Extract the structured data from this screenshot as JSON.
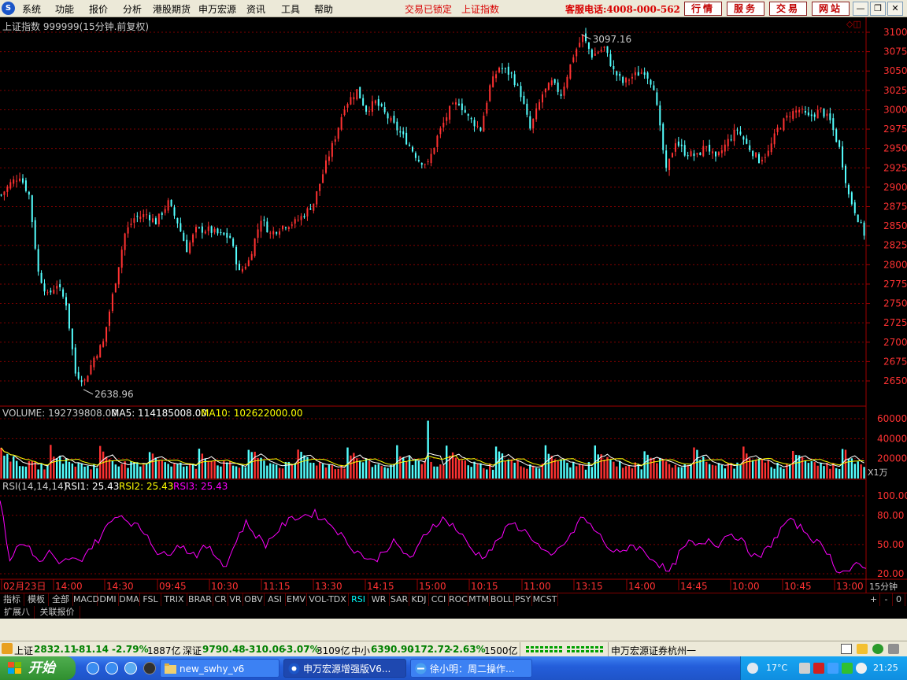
{
  "menubar": {
    "app_icon_glyph": "S",
    "items": [
      "系统",
      "功能",
      "报价",
      "分析",
      "港股期货",
      "申万宏源",
      "资讯",
      "工具",
      "帮助"
    ],
    "lock_status": "交易已锁定",
    "current_index": "上证指数",
    "hotline": "客服电话:4008-000-562",
    "buttons": [
      "行情",
      "服务",
      "交易",
      "网站"
    ],
    "window_controls": [
      "—",
      "❐",
      "✕"
    ]
  },
  "chart": {
    "title": "上证指数 999999(15分钟.前复权)",
    "high_label": "3097.16",
    "low_label": "2638.96",
    "price_ticks": [
      3100,
      3075,
      3050,
      3025,
      3000,
      2975,
      2950,
      2925,
      2900,
      2875,
      2850,
      2825,
      2800,
      2775,
      2750,
      2725,
      2700,
      2675,
      2650
    ],
    "volume": {
      "label": "VOLUME: 192739808.00",
      "ma5": "MA5: 114185008.00",
      "ma10": "MA10: 102622000.00",
      "ticks": [
        "60000",
        "40000",
        "20000"
      ],
      "unit": "X1万"
    },
    "rsi": {
      "label": "RSI(14,14,14)",
      "rsi1": "RSI1: 25.43",
      "rsi2": "RSI2: 25.43",
      "rsi3": "RSI3: 25.43",
      "ticks": [
        "100.00",
        "80.00",
        "50.00",
        "20.00"
      ]
    },
    "time_labels": [
      "02月23日",
      "14:00",
      "14:30",
      "09:45",
      "10:30",
      "11:15",
      "13:30",
      "14:15",
      "15:00",
      "10:15",
      "11:00",
      "13:15",
      "14:00",
      "14:45",
      "10:00",
      "10:45",
      "13:00"
    ],
    "period": "15分钟",
    "colors": {
      "up": "#ff3232",
      "down": "#54ffff",
      "ma5": "#ffffff",
      "ma10": "#ffff00",
      "rsi": "#ff00ff",
      "grid": "#800000"
    }
  },
  "chart_data": {
    "type": "candlestick",
    "title": "上证指数 999999(15分钟.前复权)",
    "ylim": [
      2625,
      3110
    ],
    "y_ticks": [
      3100,
      3075,
      3050,
      3025,
      3000,
      2975,
      2950,
      2925,
      2900,
      2875,
      2850,
      2825,
      2800,
      2775,
      2750,
      2725,
      2700,
      2675,
      2650
    ],
    "annotations": [
      {
        "label": "3097.16",
        "value": 3097.16
      },
      {
        "label": "2638.96",
        "value": 2638.96
      }
    ],
    "close_path": [
      [
        0,
        2890
      ],
      [
        3,
        2905
      ],
      [
        6,
        2915
      ],
      [
        9,
        2890
      ],
      [
        12,
        2790
      ],
      [
        15,
        2760
      ],
      [
        18,
        2775
      ],
      [
        21,
        2750
      ],
      [
        24,
        2660
      ],
      [
        27,
        2650
      ],
      [
        30,
        2680
      ],
      [
        33,
        2700
      ],
      [
        37,
        2780
      ],
      [
        40,
        2840
      ],
      [
        43,
        2860
      ],
      [
        47,
        2865
      ],
      [
        50,
        2855
      ],
      [
        54,
        2880
      ],
      [
        57,
        2855
      ],
      [
        60,
        2820
      ],
      [
        63,
        2845
      ],
      [
        67,
        2845
      ],
      [
        70,
        2840
      ],
      [
        74,
        2835
      ],
      [
        77,
        2790
      ],
      [
        80,
        2805
      ],
      [
        84,
        2860
      ],
      [
        87,
        2840
      ],
      [
        91,
        2850
      ],
      [
        95,
        2855
      ],
      [
        98,
        2865
      ],
      [
        101,
        2880
      ],
      [
        105,
        2930
      ],
      [
        108,
        2965
      ],
      [
        111,
        3005
      ],
      [
        115,
        3025
      ],
      [
        118,
        3000
      ],
      [
        121,
        3010
      ],
      [
        125,
        2990
      ],
      [
        128,
        2975
      ],
      [
        131,
        2960
      ],
      [
        135,
        2935
      ],
      [
        138,
        2930
      ],
      [
        141,
        2965
      ],
      [
        145,
        3000
      ],
      [
        148,
        3010
      ],
      [
        151,
        2990
      ],
      [
        155,
        2975
      ],
      [
        158,
        3030
      ],
      [
        161,
        3055
      ],
      [
        165,
        3045
      ],
      [
        168,
        3020
      ],
      [
        171,
        2975
      ],
      [
        175,
        3020
      ],
      [
        178,
        3035
      ],
      [
        181,
        3020
      ],
      [
        185,
        3070
      ],
      [
        188,
        3095
      ],
      [
        191,
        3070
      ],
      [
        195,
        3080
      ],
      [
        198,
        3050
      ],
      [
        201,
        3035
      ],
      [
        205,
        3045
      ],
      [
        208,
        3050
      ],
      [
        211,
        3030
      ],
      [
        215,
        2920
      ],
      [
        218,
        2960
      ],
      [
        221,
        2945
      ],
      [
        225,
        2940
      ],
      [
        228,
        2955
      ],
      [
        231,
        2935
      ],
      [
        235,
        2960
      ],
      [
        238,
        2975
      ],
      [
        241,
        2955
      ],
      [
        245,
        2935
      ],
      [
        248,
        2945
      ],
      [
        251,
        2975
      ],
      [
        255,
        2995
      ],
      [
        258,
        3000
      ],
      [
        261,
        2990
      ],
      [
        265,
        3000
      ],
      [
        268,
        2985
      ],
      [
        271,
        2950
      ],
      [
        274,
        2890
      ],
      [
        277,
        2860
      ],
      [
        280,
        2830
      ]
    ],
    "volume_ticks": [
      60000,
      40000,
      20000
    ],
    "rsi_ticks": [
      100,
      80,
      50,
      20
    ],
    "rsi_path": [
      [
        0,
        95
      ],
      [
        3,
        35
      ],
      [
        6,
        50
      ],
      [
        9,
        48
      ],
      [
        12,
        30
      ],
      [
        15,
        42
      ],
      [
        18,
        28
      ],
      [
        21,
        36
      ],
      [
        24,
        32
      ],
      [
        27,
        45
      ],
      [
        30,
        55
      ],
      [
        33,
        70
      ],
      [
        36,
        82
      ],
      [
        39,
        75
      ],
      [
        42,
        68
      ],
      [
        45,
        60
      ],
      [
        48,
        42
      ],
      [
        51,
        38
      ],
      [
        54,
        52
      ],
      [
        57,
        44
      ],
      [
        60,
        40
      ],
      [
        63,
        48
      ],
      [
        66,
        38
      ],
      [
        69,
        28
      ],
      [
        72,
        55
      ],
      [
        75,
        72
      ],
      [
        78,
        60
      ],
      [
        81,
        50
      ],
      [
        84,
        62
      ],
      [
        87,
        72
      ],
      [
        90,
        78
      ],
      [
        93,
        80
      ],
      [
        96,
        82
      ],
      [
        99,
        75
      ],
      [
        102,
        68
      ],
      [
        105,
        55
      ],
      [
        108,
        45
      ],
      [
        111,
        38
      ],
      [
        114,
        32
      ],
      [
        117,
        44
      ],
      [
        120,
        52
      ],
      [
        123,
        42
      ],
      [
        126,
        36
      ],
      [
        129,
        58
      ],
      [
        132,
        70
      ],
      [
        135,
        76
      ],
      [
        138,
        70
      ],
      [
        141,
        58
      ],
      [
        144,
        44
      ],
      [
        147,
        38
      ],
      [
        150,
        46
      ],
      [
        153,
        60
      ],
      [
        156,
        72
      ],
      [
        159,
        66
      ],
      [
        162,
        58
      ],
      [
        165,
        45
      ],
      [
        168,
        36
      ],
      [
        171,
        48
      ],
      [
        174,
        58
      ],
      [
        177,
        78
      ],
      [
        180,
        70
      ],
      [
        183,
        58
      ],
      [
        186,
        45
      ],
      [
        189,
        40
      ],
      [
        192,
        50
      ],
      [
        195,
        46
      ],
      [
        198,
        38
      ],
      [
        201,
        30
      ],
      [
        204,
        20
      ],
      [
        207,
        40
      ],
      [
        210,
        52
      ],
      [
        213,
        48
      ],
      [
        216,
        56
      ],
      [
        219,
        50
      ],
      [
        222,
        62
      ],
      [
        225,
        58
      ],
      [
        228,
        45
      ],
      [
        231,
        35
      ],
      [
        234,
        46
      ],
      [
        237,
        60
      ],
      [
        240,
        75
      ],
      [
        243,
        70
      ],
      [
        246,
        62
      ],
      [
        249,
        52
      ],
      [
        252,
        44
      ],
      [
        255,
        25
      ],
      [
        258,
        22
      ],
      [
        261,
        28
      ],
      [
        264,
        25
      ]
    ],
    "rsi_label": "RSI(14,14,14)"
  },
  "indicator_tabs": {
    "cn": [
      "指标",
      "模板",
      "全部"
    ],
    "items": [
      "MACD",
      "DMI",
      "DMA",
      "FSL",
      "TRIX",
      "BRAR",
      "CR",
      "VR",
      "OBV",
      "ASI",
      "EMV",
      "VOL-TDX",
      "RSI",
      "WR",
      "SAR",
      "KDJ",
      "CCI",
      "ROC",
      "MTM",
      "BOLL",
      "PSY",
      "MCST"
    ],
    "active": "RSI",
    "nav": [
      "+",
      "-",
      "0"
    ]
  },
  "ext_tabs": [
    "扩展八",
    "关联报价"
  ],
  "statusbar": {
    "sh_name": "上证",
    "sh_price": "2832.11",
    "sh_chg": "-81.14",
    "sh_pct": "-2.79%",
    "sh_amt": "1887亿",
    "sz_name": "深证",
    "sz_price": "9790.48",
    "sz_chg": "-310.06",
    "sz_pct": "-3.07%",
    "sz_amt": "3109亿",
    "zx_name": "中小",
    "zx_price": "6390.90",
    "zx_chg": "-172.72",
    "zx_pct": "-2.63%",
    "zx_amt": "1500亿",
    "broker": "申万宏源证券杭州一"
  },
  "taskbar": {
    "start": "开始",
    "tasks": [
      "new_swhy_v6",
      "申万宏源增强版V6...",
      "徐小明：周二操作..."
    ],
    "temperature": "17°C",
    "clock": "21:25"
  }
}
